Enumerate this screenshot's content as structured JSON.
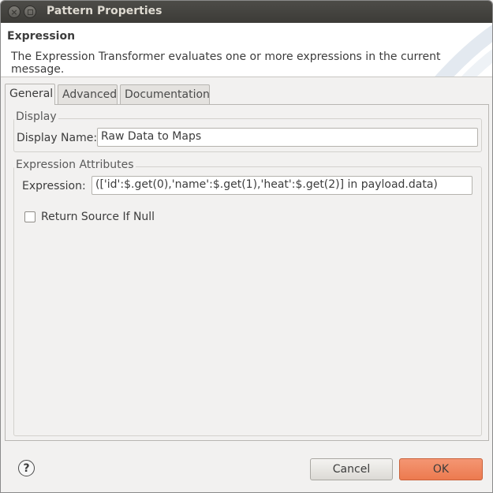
{
  "window": {
    "title": "Pattern Properties",
    "close_glyph": "×"
  },
  "header": {
    "title": "Expression",
    "description": "The Expression Transformer evaluates one or more expressions in the current message."
  },
  "tabs": [
    {
      "label": "General",
      "active": true
    },
    {
      "label": "Advanced",
      "active": false
    },
    {
      "label": "Documentation",
      "active": false
    }
  ],
  "display_group": {
    "label": "Display",
    "display_name_label": "Display Name:",
    "display_name_value": "Raw Data to Maps"
  },
  "expression_group": {
    "label": "Expression Attributes",
    "expression_label": "Expression:",
    "expression_value": "(['id':$.get(0),'name':$.get(1),'heat':$.get(2)] in payload.data)",
    "return_source_label": "Return Source If Null",
    "return_source_checked": false
  },
  "footer": {
    "help_glyph": "?",
    "cancel_label": "Cancel",
    "ok_label": "OK"
  },
  "colors": {
    "titlebar": "#3c3b37",
    "ok_button": "#ec7a4f",
    "background": "#f2f1f0"
  }
}
